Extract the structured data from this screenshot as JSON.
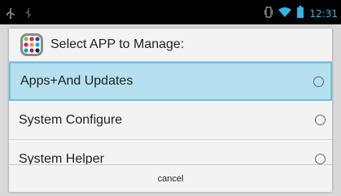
{
  "status_bar": {
    "left_icons": [
      "usb-icon",
      "usb-debug-icon"
    ],
    "right_icons": [
      "vibrate-icon",
      "wifi-icon",
      "battery-icon"
    ],
    "time": "12:31",
    "accent_color": "#33b5e5"
  },
  "dialog": {
    "icon": "app-icon",
    "title": "Select APP to Manage:",
    "items": [
      {
        "label": "Apps+And Updates",
        "selected": true
      },
      {
        "label": "System Configure",
        "selected": false
      },
      {
        "label": "System Helper",
        "selected": false
      }
    ],
    "cancel_label": "cancel",
    "selection_color": "#b5e0ef"
  }
}
